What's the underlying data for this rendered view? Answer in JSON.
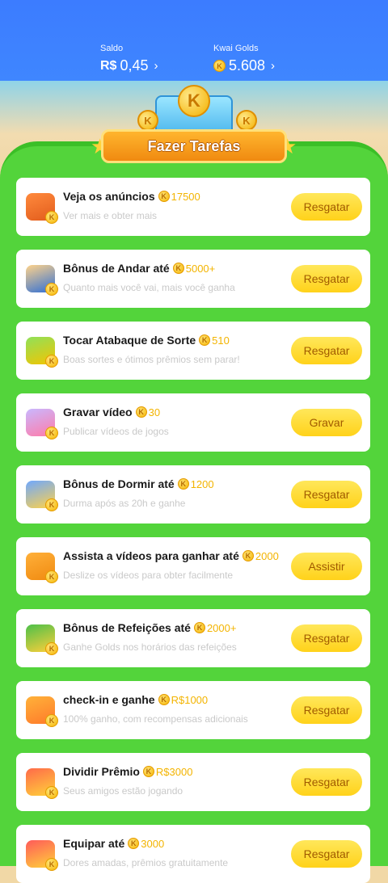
{
  "header": {
    "saldo_label": "Saldo",
    "saldo_currency": "R$",
    "saldo_value": "0,45",
    "golds_label": "Kwai Golds",
    "golds_value": "5.608",
    "chevron": "›"
  },
  "banner": {
    "title": "Fazer Tarefas",
    "coin_letter": "K"
  },
  "colors": {
    "accent": "#ffd21a",
    "board": "#53d43b",
    "header": "#3f86ff",
    "reward": "#f3b400"
  },
  "tasks": [
    {
      "icon": "tv-icon",
      "title": "Veja os anúncios",
      "reward": "17500",
      "subtitle": "Ver mais e obter mais",
      "button": "Resgatar"
    },
    {
      "icon": "walking-boy-icon",
      "title": "Bônus de Andar até",
      "reward": "5000+",
      "subtitle": "Quanto mais você vai, mais você ganha",
      "button": "Resgatar"
    },
    {
      "icon": "drum-icon",
      "title": "Tocar Atabaque de Sorte",
      "reward": "510",
      "subtitle": "Boas sortes e ótimos prêmios sem parar!",
      "button": "Resgatar"
    },
    {
      "icon": "video-record-icon",
      "title": "Gravar vídeo",
      "reward": "30",
      "subtitle": "Publicar vídeos de jogos",
      "button": "Gravar"
    },
    {
      "icon": "sleep-moon-icon",
      "title": "Bônus de Dormir até",
      "reward": "1200",
      "subtitle": "Durma após as 20h e ganhe",
      "button": "Resgatar"
    },
    {
      "icon": "camera-icon",
      "title": "Assista a vídeos para ganhar até",
      "reward": "2000",
      "subtitle": "Deslize os vídeos para obter facilmente",
      "button": "Assistir"
    },
    {
      "icon": "meal-icon",
      "title": "Bônus de Refeições até",
      "reward": "2000+",
      "subtitle": "Ganhe Golds nos horários das refeições",
      "button": "Resgatar"
    },
    {
      "icon": "calendar-icon",
      "title": "check-in e ganhe",
      "reward": "R$1000",
      "subtitle": "100% ganho, com recompensas adicionais",
      "button": "Resgatar"
    },
    {
      "icon": "gift-icon",
      "title": "Dividir Prêmio",
      "reward": "R$3000",
      "subtitle": "Seus amigos estão jogando",
      "button": "Resgatar"
    },
    {
      "icon": "equip-icon",
      "title": "Equipar até",
      "reward": "3000",
      "subtitle": "Dores amadas, prêmios gratuitamente",
      "button": "Resgatar"
    }
  ]
}
